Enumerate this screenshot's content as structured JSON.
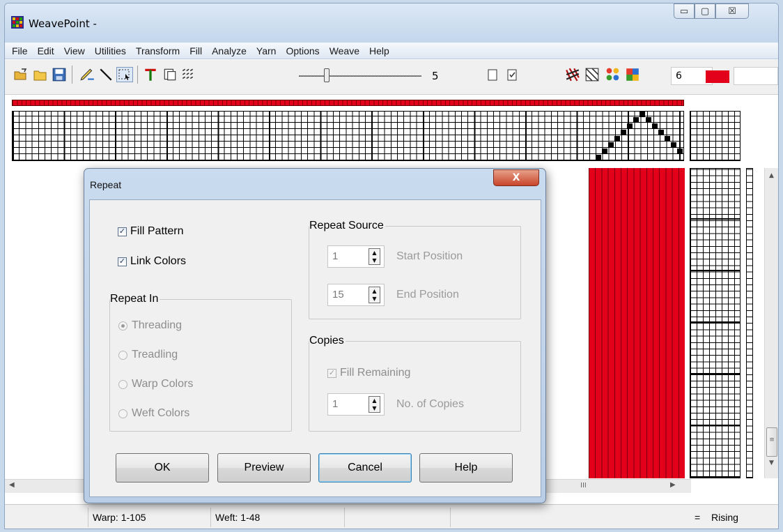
{
  "window": {
    "title": "WeavePoint -"
  },
  "window_buttons": {
    "minimize": "▭",
    "maximize": "▢",
    "close": "☒"
  },
  "menu": [
    "File",
    "Edit",
    "View",
    "Utilities",
    "Transform",
    "Fill",
    "Analyze",
    "Yarn",
    "Options",
    "Weave",
    "Help"
  ],
  "toolbar": {
    "slider_value": "5",
    "color_number": "6",
    "color_swatch": "#e2001a"
  },
  "dialog": {
    "title": "Repeat",
    "close_label": "X",
    "fill_pattern": {
      "label": "Fill Pattern",
      "checked": true
    },
    "link_colors": {
      "label": "Link Colors",
      "checked": true
    },
    "repeat_in": {
      "title": "Repeat In",
      "options": [
        "Threading",
        "Treadling",
        "Warp Colors",
        "Weft Colors"
      ],
      "selected": "Threading"
    },
    "repeat_source": {
      "title": "Repeat Source",
      "start_value": "1",
      "start_label": "Start Position",
      "end_value": "15",
      "end_label": "End Position"
    },
    "copies": {
      "title": "Copies",
      "fill_remaining": {
        "label": "Fill Remaining",
        "checked": true
      },
      "copies_value": "1",
      "copies_label": "No. of Copies"
    },
    "buttons": {
      "ok": "OK",
      "preview": "Preview",
      "cancel": "Cancel",
      "help": "Help"
    }
  },
  "status": {
    "warp": "Warp: 1-105",
    "weft": "Weft: 1-48",
    "eq": "=",
    "mode": "Rising"
  },
  "scroll_glyphs": {
    "up": "▲",
    "down": "▼",
    "left": "◀",
    "right": "▶",
    "grip_v": "≡",
    "grip_h": "III"
  }
}
